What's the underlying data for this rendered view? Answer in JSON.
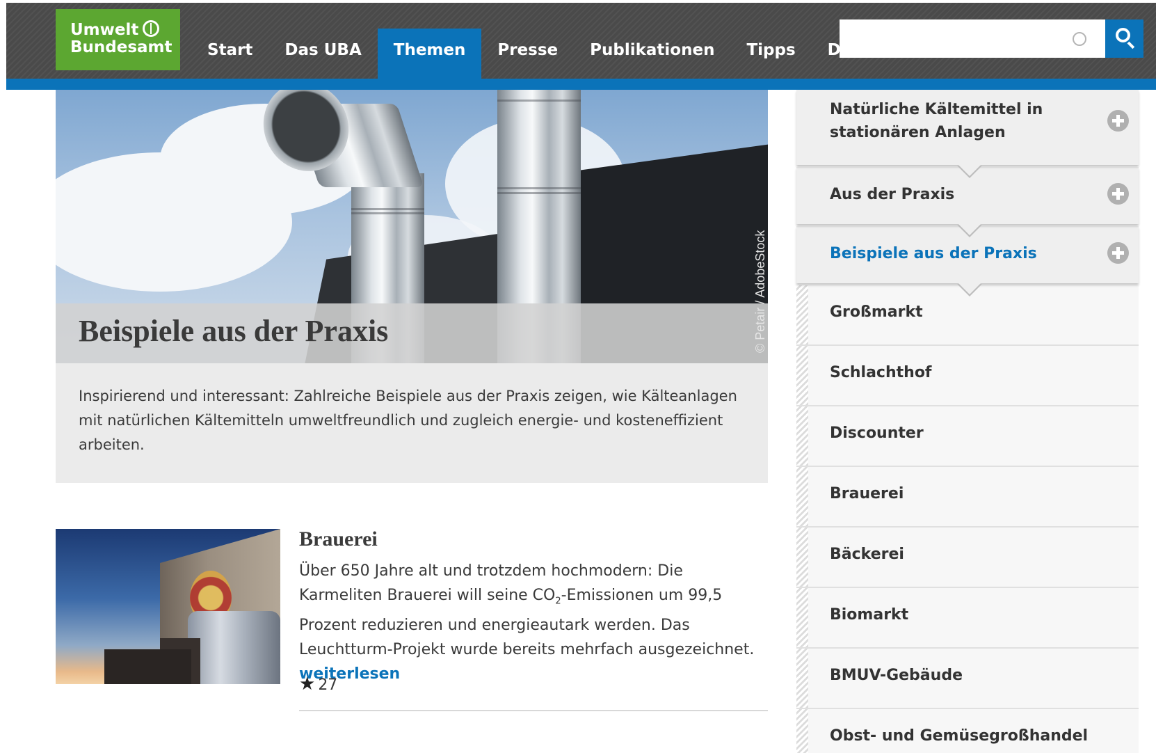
{
  "header": {
    "logo": {
      "line1": "Umwelt",
      "line2": "Bundesamt"
    },
    "nav": [
      {
        "label": "Start"
      },
      {
        "label": "Das UBA"
      },
      {
        "label": "Themen",
        "active": true
      },
      {
        "label": "Presse"
      },
      {
        "label": "Publikationen"
      },
      {
        "label": "Tipps"
      },
      {
        "label": "Daten"
      }
    ],
    "search": {
      "value": "",
      "placeholder": ""
    }
  },
  "hero": {
    "title": "Beispiele aus der Praxis",
    "credit": "© Petair / AdobeStock",
    "intro": "Inspirierend und interessant: Zahlreiche  Beispiele aus der Praxis zeigen, wie Kälteanlagen mit natürlichen Kältemitteln umweltfreundlich und zugleich energie- und kosteneffizient arbeiten."
  },
  "teaser": {
    "title": "Brauerei",
    "text_before": "Über 650 Jahre alt und trotzdem hochmodern: Die Karmeliten Brauerei will seine CO",
    "text_sub": "2",
    "text_after": "-Emissionen um 99,5 Prozent reduzieren und energieautark werden. Das Leuchtturm-Projekt wurde bereits mehrfach ausgezeichnet. ",
    "readmore": "weiterlesen",
    "rating_count": "27"
  },
  "sidebar": {
    "sections": [
      {
        "label_line1": "Natürliche Kältemittel in",
        "label_line2": "stationären Anlagen"
      },
      {
        "label": "Aus der Praxis"
      },
      {
        "label": "Beispiele aus der Praxis",
        "active": true
      }
    ],
    "items": [
      {
        "label": "Großmarkt"
      },
      {
        "label": "Schlachthof"
      },
      {
        "label": "Discounter"
      },
      {
        "label": "Brauerei"
      },
      {
        "label": "Bäckerei"
      },
      {
        "label": "Biomarkt"
      },
      {
        "label": "BMUV-Gebäude"
      },
      {
        "label": "Obst- und Gemüsegroßhandel"
      }
    ]
  },
  "colors": {
    "brand_green": "#5ca731",
    "brand_blue": "#0b73b9",
    "header_dark": "#4a4a4a"
  },
  "icons": {
    "search": "search-icon",
    "clear": "clear-icon",
    "expand": "plus-circle-icon",
    "rating": "star-icon"
  }
}
